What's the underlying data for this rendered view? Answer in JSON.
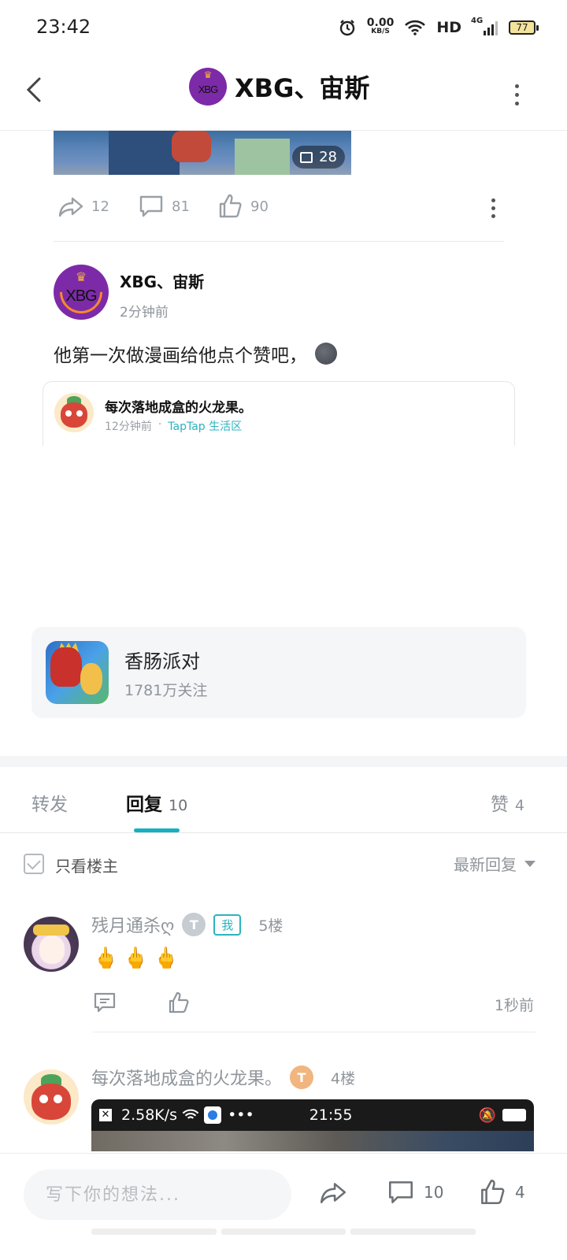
{
  "status": {
    "time": "23:42",
    "net_speed": "0.00",
    "net_unit": "KB/S",
    "hd": "HD",
    "network": "4G",
    "battery": "77"
  },
  "header": {
    "title": "XBG、宙斯",
    "avatar_text": "XBG"
  },
  "prev_post": {
    "image_count": "28",
    "share_count": "12",
    "comment_count": "81",
    "like_count": "90"
  },
  "post": {
    "author": "XBG、宙斯",
    "time": "2分钟前",
    "text": "他第一次做漫画给他点个赞吧，",
    "quote": {
      "title": "每次落地成盒的火龙果。",
      "time": "12分钟前",
      "separator": "·",
      "tag": "TapTap 生活区"
    }
  },
  "game": {
    "name": "香肠派对",
    "followers": "1781万关注"
  },
  "tabs": [
    {
      "label": "转发",
      "count": ""
    },
    {
      "label": "回复",
      "count": "10"
    },
    {
      "label": "赞",
      "count": "4"
    }
  ],
  "filter": {
    "only_op": "只看楼主",
    "sort": "最新回复"
  },
  "comments": [
    {
      "name": "残月通杀ღ",
      "level": "T",
      "badge": "我",
      "floor": "5楼",
      "text": "🖕🖕🖕",
      "time": "1秒前"
    },
    {
      "name": "每次落地成盒的火龙果。",
      "level": "T",
      "floor": "4楼",
      "shot_status": "2.58K/s",
      "shot_time": "21:55"
    }
  ],
  "bottom": {
    "placeholder": "写下你的想法...",
    "comment_count": "10",
    "like_count": "4"
  }
}
